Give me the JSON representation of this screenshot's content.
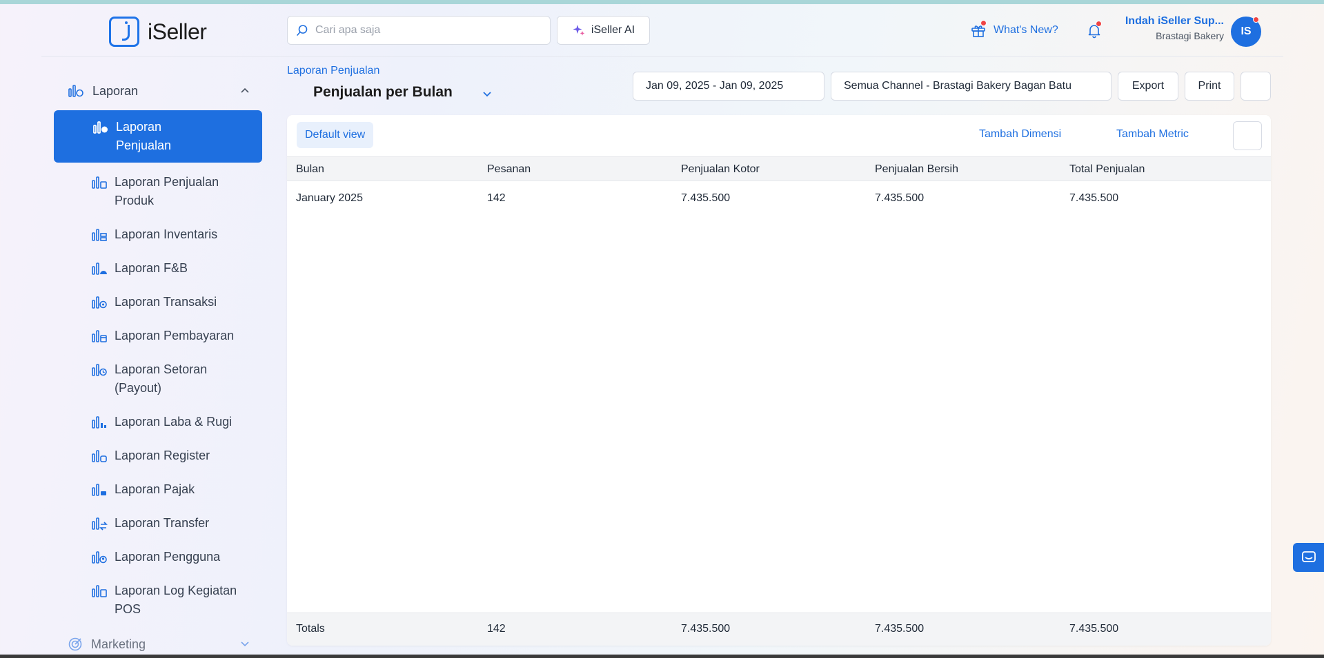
{
  "app": {
    "name": "iSeller"
  },
  "header": {
    "search_placeholder": "Cari apa saja",
    "ai_button": "iSeller AI",
    "whats_new": "What's New?",
    "user_name": "Indah iSeller Sup...",
    "user_store": "Brastagi Bakery",
    "avatar_initials": "IS"
  },
  "sidebar": {
    "section": "Laporan",
    "items": [
      {
        "label": "Laporan Penjualan",
        "active": true
      },
      {
        "label": "Laporan Penjualan Produk"
      },
      {
        "label": "Laporan Inventaris"
      },
      {
        "label": "Laporan F&B"
      },
      {
        "label": "Laporan Transaksi"
      },
      {
        "label": "Laporan Pembayaran"
      },
      {
        "label": "Laporan Setoran (Payout)"
      },
      {
        "label": "Laporan Laba & Rugi"
      },
      {
        "label": "Laporan Register"
      },
      {
        "label": "Laporan Pajak"
      },
      {
        "label": "Laporan Transfer"
      },
      {
        "label": "Laporan Pengguna"
      },
      {
        "label": "Laporan Log Kegiatan POS"
      }
    ],
    "next_section": "Marketing"
  },
  "page": {
    "breadcrumb": "Laporan Penjualan",
    "title": "Penjualan per Bulan",
    "date_range": "Jan 09, 2025 - Jan 09, 2025",
    "channel": "Semua Channel - Brastagi Bakery Bagan Batu",
    "export": "Export",
    "print": "Print"
  },
  "toolbar": {
    "default_view": "Default view",
    "add_dimension": "Tambah Dimensi",
    "add_metric": "Tambah Metric"
  },
  "table": {
    "columns": [
      "Bulan",
      "Pesanan",
      "Penjualan Kotor",
      "Penjualan Bersih",
      "Total Penjualan"
    ],
    "rows": [
      [
        "January 2025",
        "142",
        "7.435.500",
        "7.435.500",
        "7.435.500"
      ]
    ],
    "totals": [
      "Totals",
      "142",
      "7.435.500",
      "7.435.500",
      "7.435.500"
    ]
  },
  "colors": {
    "accent": "#1e6fe0",
    "notification": "#ef4444"
  }
}
